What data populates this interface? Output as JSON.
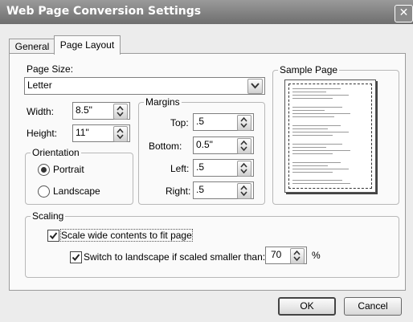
{
  "window": {
    "title": "Web Page Conversion Settings",
    "close_glyph": "✕"
  },
  "tabs": [
    {
      "label": "General"
    },
    {
      "label": "Page Layout"
    }
  ],
  "page_size": {
    "label": "Page Size:",
    "value": "Letter"
  },
  "width": {
    "label": "Width:",
    "value": "8.5\""
  },
  "height": {
    "label": "Height:",
    "value": "11\""
  },
  "orientation": {
    "legend": "Orientation",
    "portrait": "Portrait",
    "landscape": "Landscape",
    "selected": "Portrait"
  },
  "margins": {
    "legend": "Margins",
    "top": {
      "label": "Top:",
      "value": ".5"
    },
    "bottom": {
      "label": "Bottom:",
      "value": "0.5\""
    },
    "left": {
      "label": "Left:",
      "value": ".5"
    },
    "right": {
      "label": "Right:",
      "value": ".5"
    }
  },
  "sample": {
    "legend": "Sample Page"
  },
  "scaling": {
    "legend": "Scaling",
    "scale_wide": {
      "label": "Scale wide contents to fit page",
      "checked": true
    },
    "switch_landscape": {
      "label": "Switch to landscape if scaled smaller than:",
      "checked": true,
      "value": "70",
      "unit": "%"
    }
  },
  "buttons": {
    "ok": "OK",
    "cancel": "Cancel"
  },
  "colors": {
    "titlebar": "#7a7a7a",
    "panel": "#fafafa"
  }
}
